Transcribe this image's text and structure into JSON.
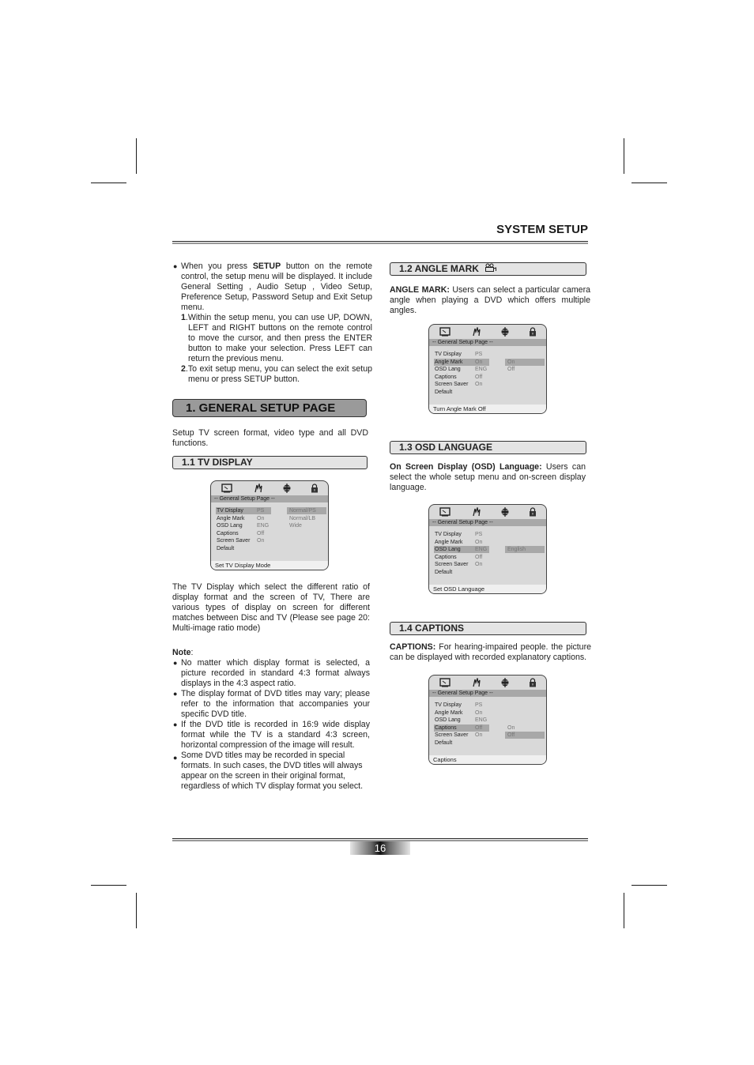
{
  "header": {
    "title": "SYSTEM SETUP"
  },
  "intro": {
    "bullet_prefix": "When you press ",
    "bullet_bold": "SETUP",
    "bullet_suffix": " button on the remote control, the setup menu will be displayed. It include General Setting , Audio Setup , Video Setup, Preference Setup, Password Setup and Exit Setup menu.",
    "steps": [
      {
        "num": "1",
        "text": ".Within the setup menu, you can use UP, DOWN, LEFT and RIGHT buttons on the remote control to move the cursor, and then press the ENTER button to make your selection. Press LEFT can return the previous menu."
      },
      {
        "num": "2",
        "text": ".To exit setup menu, you can select the exit setup menu or press SETUP button."
      }
    ]
  },
  "general_setup": {
    "heading": "1. GENERAL SETUP PAGE",
    "description": "Setup TV screen format, video type and all DVD functions."
  },
  "osd_common": {
    "tabs": [
      "tv-display-tab",
      "audio-tab",
      "video-tab",
      "password-tab"
    ],
    "page_title": "-- General Setup Page --",
    "rows": [
      {
        "label": "TV Display",
        "value": "PS"
      },
      {
        "label": "Angle Mark",
        "value": "On"
      },
      {
        "label": "OSD Lang",
        "value": "ENG"
      },
      {
        "label": "Captions",
        "value": "Off"
      },
      {
        "label": "Screen Saver",
        "value": "On"
      },
      {
        "label": "Default",
        "value": ""
      }
    ]
  },
  "tv_display": {
    "heading": "1.1 TV DISPLAY",
    "osd": {
      "selected_row": 0,
      "options": [
        {
          "label": "Normal/PS",
          "selected": true
        },
        {
          "label": "Normal/LB",
          "selected": false
        },
        {
          "label": "Wide",
          "selected": false
        }
      ],
      "status": "Set TV Display Mode"
    },
    "description": "The TV Display which select the different ratio of display format and the screen of TV, There are various types of display on screen for different matches between Disc and TV (Please see page 20: Multi-image ratio mode)",
    "note_label": "Note",
    "note_colon": ":",
    "notes": [
      "No matter which display format is selected, a picture recorded in standard 4:3 format always displays in the 4:3 aspect ratio.",
      "The display format of DVD titles may vary; please refer to the information that accompanies your specific DVD title.",
      "If the DVD title is recorded in 16:9 wide display format while the TV is a standard 4:3 screen, horizontal compression of the image will result.",
      "Some DVD titles may be recorded in special formats. In such cases, the DVD titles will always appear on the screen in their original format, regardless of which TV display format you select."
    ]
  },
  "angle_mark": {
    "heading": "1.2 ANGLE MARK",
    "heading_icon": "camera-angle-icon",
    "lead_bold": "ANGLE MARK:",
    "lead_text": " Users can select a particular camera angle when playing a DVD which offers multiple angles.",
    "osd": {
      "selected_row": 1,
      "options": [
        {
          "label": "On",
          "selected": true
        },
        {
          "label": "Off",
          "selected": false
        }
      ],
      "status": "Turn Angle Mark Off"
    }
  },
  "osd_language": {
    "heading": "1.3 OSD LANGUAGE",
    "lead_bold": "On Screen Display (OSD) Language:",
    "lead_text": " Users can select the whole setup menu and on-screen display language.",
    "osd": {
      "selected_row": 2,
      "options": [
        {
          "label": "English",
          "selected": true
        }
      ],
      "status": "Set OSD Language"
    }
  },
  "captions": {
    "heading": "1.4 CAPTIONS",
    "lead_bold": "CAPTIONS:",
    "lead_text": " For hearing-impaired people. the picture can be displayed with recorded explanatory captions.",
    "osd": {
      "selected_row": 3,
      "options": [
        {
          "label": "On",
          "selected": false
        },
        {
          "label": "Off",
          "selected": true
        }
      ],
      "status": "Captions"
    }
  },
  "footer": {
    "page_number": "16"
  }
}
